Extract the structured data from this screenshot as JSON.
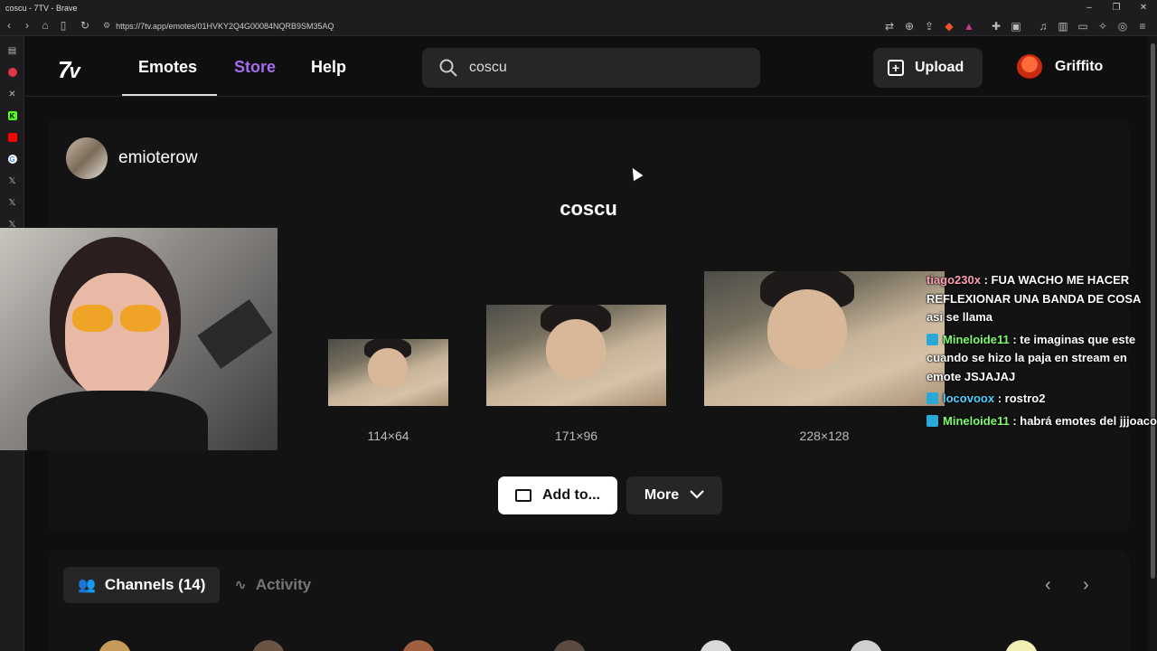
{
  "browser": {
    "window_title": "coscu - 7TV - Brave",
    "url": "https://7tv.app/emotes/01HVKY2Q4G00084NQRB9SM35AQ"
  },
  "nav": {
    "links": [
      "Emotes",
      "Store",
      "Help"
    ],
    "search_value": "coscu",
    "upload_label": "Upload",
    "username": "Griffito",
    "accent_color": "#a66bf0"
  },
  "emote": {
    "author": "emioterow",
    "name": "coscu",
    "sizes": [
      "114×64",
      "171×96",
      "228×128"
    ],
    "add_label": "Add to...",
    "more_label": "More"
  },
  "channels": {
    "tabs": [
      "Channels (14)",
      "Activity"
    ]
  },
  "chat": [
    {
      "user": "tiago230x",
      "text": " : FUA WACHO ME HACER REFLEXIONAR UNA BANDA DE COSA asi se llama",
      "badge": false,
      "cls": "u0"
    },
    {
      "user": "Mineloide11",
      "text": " : te imaginas que este cuando se hizo la paja en stream en emote JSJAJAJ",
      "badge": true,
      "cls": "u1"
    },
    {
      "user": "locovoox",
      "text": " : rostro2",
      "badge": true,
      "cls": "u2"
    },
    {
      "user": "Mineloide11",
      "text": " : habrá emotes del jjjoaco",
      "badge": true,
      "cls": "u1"
    }
  ]
}
